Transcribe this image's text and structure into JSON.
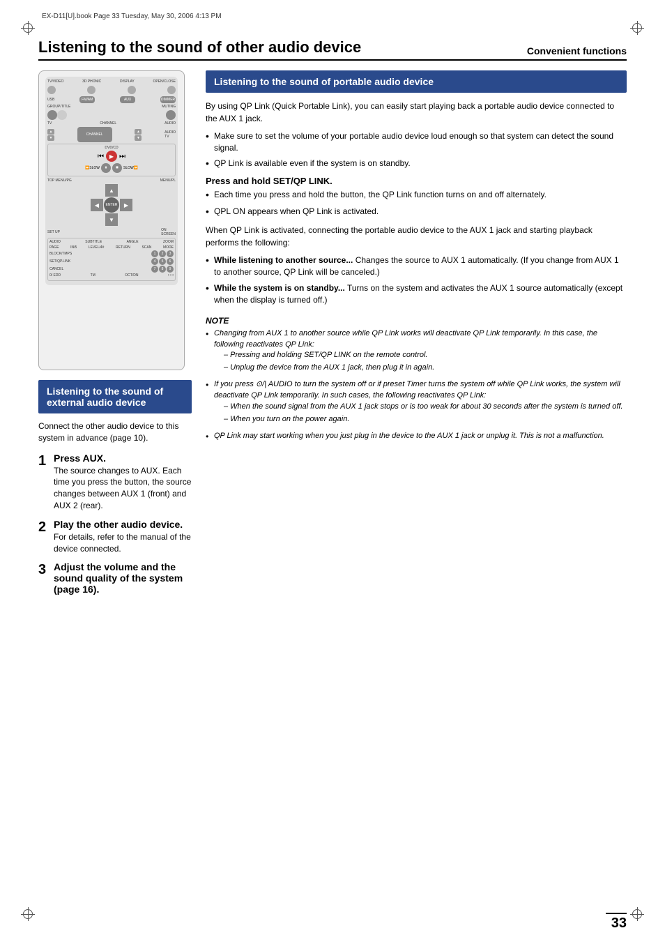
{
  "meta": {
    "file_info": "EX-D11[U].book  Page 33  Tuesday, May 30, 2006  4:13 PM",
    "page_number": "33"
  },
  "header": {
    "main_title": "Listening to the sound of other audio device",
    "subtitle": "Convenient functions"
  },
  "left_section": {
    "box_title": "Listening to the sound of external audio device",
    "connect_desc": "Connect the other audio device to this system in advance (page 10).",
    "steps": [
      {
        "number": "1",
        "title": "Press AUX.",
        "desc": "The source changes to AUX.\nEach time you press the button, the source changes between AUX 1 (front) and AUX 2 (rear)."
      },
      {
        "number": "2",
        "title": "Play the other audio device.",
        "desc": "For details, refer to the manual of the device connected."
      },
      {
        "number": "3",
        "title": "Adjust the volume and the sound quality of the system (page 16)."
      }
    ]
  },
  "right_section": {
    "box_title": "Listening to the sound of portable audio device",
    "intro": "By using QP Link (Quick Portable Link), you can easily start playing back a portable audio device connected to the AUX 1 jack.",
    "bullets": [
      "Make sure to set the volume of your portable audio device loud enough so that system can detect the sound signal.",
      "QP Link is available even if the system is on standby."
    ],
    "press_hold_title": "Press and hold SET/QP LINK.",
    "press_hold_bullets": [
      "Each time you press and hold the button, the QP Link function turns on and off alternately.",
      "QPL ON appears when QP Link is activated."
    ],
    "when_activated": "When QP Link is activated, connecting the portable audio device to the AUX 1 jack and starting playback performs the following:",
    "activated_bullets": [
      {
        "bold": "While listening to another source...",
        "text": " Changes the source to AUX 1 automatically. (If you change from AUX 1 to another source, QP Link will be canceled.)"
      },
      {
        "bold": "While the system is on standby...",
        "text": " Turns on the system and activates the AUX 1 source automatically (except when the display is turned off.)"
      }
    ],
    "note": {
      "title": "NOTE",
      "items": [
        {
          "text": "Changing from AUX 1 to another source while QP Link works will deactivate QP Link temporarily. In this case, the following reactivates QP Link:",
          "sub": [
            "– Pressing and holding SET/QP LINK on the remote control.",
            "– Unplug the device from the AUX 1 jack, then plug it in again."
          ]
        },
        {
          "text": "If you press ⊙/| AUDIO to turn the system off or if preset Timer turns the system off while QP Link works, the system will deactivate QP Link temporarily. In such cases, the following reactivates QP Link:",
          "sub": [
            "– When the sound signal from the AUX 1 jack stops or is too weak for about 30 seconds after the system is turned off.",
            "– When you turn on the power again."
          ]
        },
        {
          "text": "QP Link may start working when you just plug in the device to the AUX 1 jack or unplug it. This is not a malfunction.",
          "sub": []
        }
      ]
    }
  }
}
